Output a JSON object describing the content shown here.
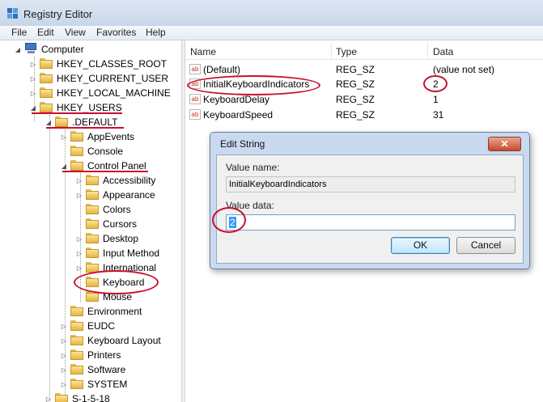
{
  "window": {
    "title": "Registry Editor",
    "icon": "registry-editor-icon"
  },
  "menu": [
    "File",
    "Edit",
    "View",
    "Favorites",
    "Help"
  ],
  "tree": {
    "root": "Computer",
    "items": [
      {
        "label": "HKEY_CLASSES_ROOT",
        "level": 1,
        "expander": "▷"
      },
      {
        "label": "HKEY_CURRENT_USER",
        "level": 1,
        "expander": "▷"
      },
      {
        "label": "HKEY_LOCAL_MACHINE",
        "level": 1,
        "expander": "▷"
      },
      {
        "label": "HKEY_USERS",
        "level": 1,
        "expander": "◢"
      },
      {
        "label": ".DEFAULT",
        "level": 2,
        "expander": "◢"
      },
      {
        "label": "AppEvents",
        "level": 3,
        "expander": "▷"
      },
      {
        "label": "Console",
        "level": 3,
        "expander": ""
      },
      {
        "label": "Control Panel",
        "level": 3,
        "expander": "◢"
      },
      {
        "label": "Accessibility",
        "level": 4,
        "expander": "▷"
      },
      {
        "label": "Appearance",
        "level": 4,
        "expander": "▷"
      },
      {
        "label": "Colors",
        "level": 4,
        "expander": ""
      },
      {
        "label": "Cursors",
        "level": 4,
        "expander": ""
      },
      {
        "label": "Desktop",
        "level": 4,
        "expander": "▷"
      },
      {
        "label": "Input Method",
        "level": 4,
        "expander": "▷"
      },
      {
        "label": "International",
        "level": 4,
        "expander": "▷"
      },
      {
        "label": "Keyboard",
        "level": 4,
        "expander": ""
      },
      {
        "label": "Mouse",
        "level": 4,
        "expander": ""
      },
      {
        "label": "Environment",
        "level": 3,
        "expander": ""
      },
      {
        "label": "EUDC",
        "level": 3,
        "expander": "▷"
      },
      {
        "label": "Keyboard Layout",
        "level": 3,
        "expander": "▷"
      },
      {
        "label": "Printers",
        "level": 3,
        "expander": "▷"
      },
      {
        "label": "Software",
        "level": 3,
        "expander": "▷"
      },
      {
        "label": "SYSTEM",
        "level": 3,
        "expander": "▷"
      },
      {
        "label": "S-1-5-18",
        "level": 2,
        "expander": "▷"
      }
    ]
  },
  "list": {
    "columns": [
      "Name",
      "Type",
      "Data"
    ],
    "rows": [
      {
        "name": "(Default)",
        "type": "REG_SZ",
        "data": "(value not set)"
      },
      {
        "name": "InitialKeyboardIndicators",
        "type": "REG_SZ",
        "data": "2"
      },
      {
        "name": "KeyboardDelay",
        "type": "REG_SZ",
        "data": "1"
      },
      {
        "name": "KeyboardSpeed",
        "type": "REG_SZ",
        "data": "31"
      }
    ]
  },
  "dialog": {
    "title": "Edit String",
    "close_label": "✕",
    "value_name_label": "Value name:",
    "value_name": "InitialKeyboardIndicators",
    "value_data_label": "Value data:",
    "value_data": "2",
    "ok_label": "OK",
    "cancel_label": "Cancel"
  },
  "colors": {
    "annotation": "#c8102e",
    "selection": "#3399ff"
  }
}
